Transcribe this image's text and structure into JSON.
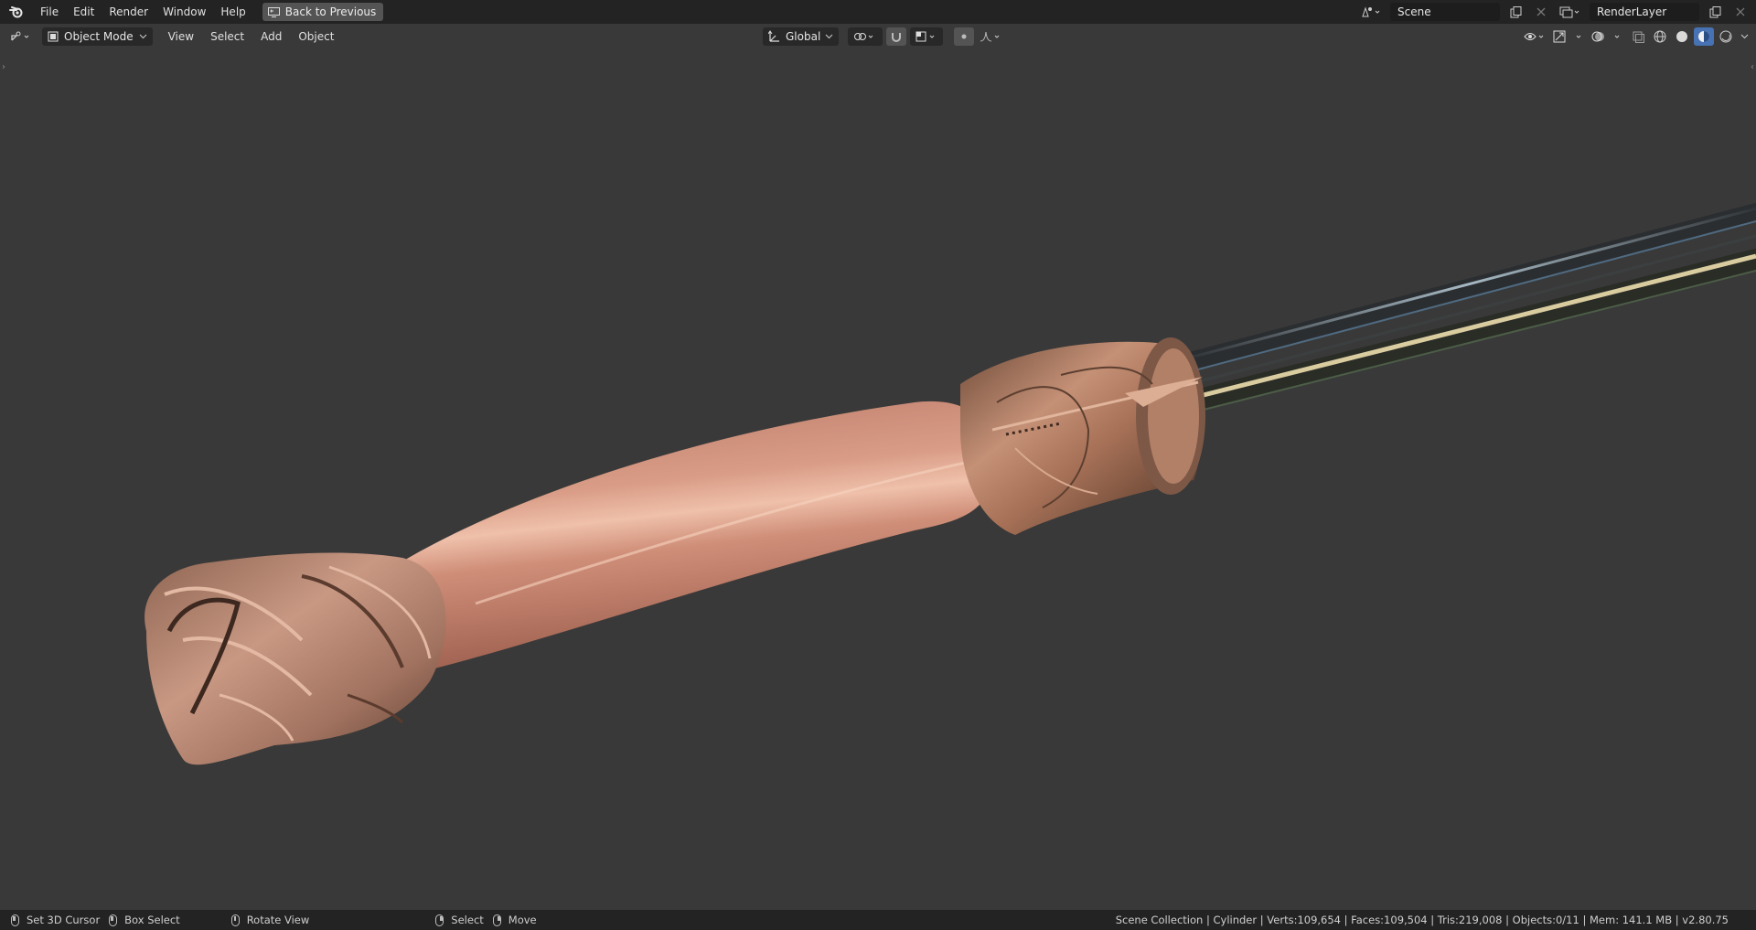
{
  "topbar": {
    "menu": [
      "File",
      "Edit",
      "Render",
      "Window",
      "Help"
    ],
    "back_button": "Back to Previous",
    "scene_name": "Scene",
    "view_layer": "RenderLayer"
  },
  "toolbar": {
    "mode": "Object Mode",
    "menu": [
      "View",
      "Select",
      "Add",
      "Object"
    ],
    "transform_orientation": "Global"
  },
  "statusbar": {
    "set_cursor": "Set 3D Cursor",
    "box_select": "Box Select",
    "rotate_view": "Rotate View",
    "select": "Select",
    "move": "Move",
    "stats": "Scene Collection | Cylinder | Verts:109,654 | Faces:109,504 | Tris:219,008 | Objects:0/11 | Mem: 141.1 MB | v2.80.75"
  },
  "colors": {
    "background": "#393939",
    "header": "#232323",
    "copper": "#c9896e",
    "bronze": "#8a6148",
    "accent_blue": "#4772b3"
  }
}
